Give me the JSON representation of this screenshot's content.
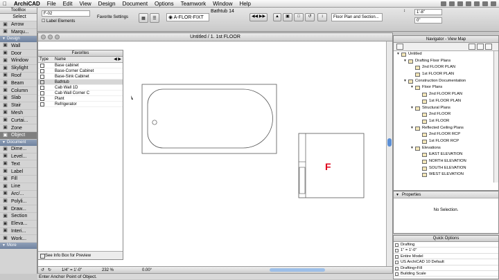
{
  "menubar": {
    "app": "ArchiCAD",
    "items": [
      "File",
      "Edit",
      "View",
      "Design",
      "Document",
      "Options",
      "Teamwork",
      "Window",
      "Help"
    ]
  },
  "infobox": {
    "id_value": "F-02",
    "label_elements": "Label Elements",
    "favorite_settings": "Favorite Settings",
    "layer_value": "A-FLOR-FIXT",
    "object_name": "Bathtub 14",
    "floor_plan_section": "Floor Plan and Section...",
    "dim_top": "1'-8\"",
    "dim_bottom": "0\"",
    "angle_value": "0\""
  },
  "toolbox": {
    "title": "ToolBox",
    "select_label": "Select",
    "design_header": "Design",
    "document_header": "Document",
    "more_label": "More",
    "select_tools": [
      {
        "label": "Arrow",
        "icon": "arrow-icon"
      },
      {
        "label": "Marqu...",
        "icon": "marquee-icon"
      }
    ],
    "design_tools": [
      {
        "label": "Wall",
        "icon": "wall-icon"
      },
      {
        "label": "Door",
        "icon": "door-icon"
      },
      {
        "label": "Window",
        "icon": "window-icon"
      },
      {
        "label": "Skylight",
        "icon": "skylight-icon"
      },
      {
        "label": "Roof",
        "icon": "roof-icon"
      },
      {
        "label": "Beam",
        "icon": "beam-icon"
      },
      {
        "label": "Column",
        "icon": "column-icon"
      },
      {
        "label": "Slab",
        "icon": "slab-icon"
      },
      {
        "label": "Stair",
        "icon": "stair-icon"
      },
      {
        "label": "Mesh",
        "icon": "mesh-icon"
      },
      {
        "label": "Curtai...",
        "icon": "curtain-wall-icon"
      },
      {
        "label": "Zone",
        "icon": "zone-icon"
      },
      {
        "label": "Object",
        "icon": "object-icon",
        "selected": true
      }
    ],
    "document_tools": [
      {
        "label": "Dime...",
        "icon": "dimension-icon"
      },
      {
        "label": "Level...",
        "icon": "level-dimension-icon"
      },
      {
        "label": "Text",
        "icon": "text-icon"
      },
      {
        "label": "Label",
        "icon": "label-icon"
      },
      {
        "label": "Fill",
        "icon": "fill-icon"
      },
      {
        "label": "Line",
        "icon": "line-icon"
      },
      {
        "label": "Arc/...",
        "icon": "arc-icon"
      },
      {
        "label": "Polyli...",
        "icon": "polyline-icon"
      },
      {
        "label": "Draw...",
        "icon": "drawing-icon"
      },
      {
        "label": "Section",
        "icon": "section-icon"
      },
      {
        "label": "Eleva...",
        "icon": "elevation-icon"
      },
      {
        "label": "Interi...",
        "icon": "interior-elevation-icon"
      },
      {
        "label": "Work...",
        "icon": "worksheet-icon"
      }
    ]
  },
  "main_window": {
    "title": "Untitled / 1. 1st FLOOR",
    "scale": "1/4\"  =  1'-0\"",
    "zoom": "232 %",
    "angle": "0.00°"
  },
  "favorites": {
    "title": "Favorites",
    "col_type": "Type",
    "col_name": "Name",
    "items": [
      "Base cabinet",
      "Base-Corner Cabinet",
      "Base-Sink Cabinet",
      "Bathtub",
      "Cab Wall 1D",
      "Cab Wall Corner C",
      "Plant",
      "Refrigerator"
    ],
    "selected_index": 3,
    "footer": "See Info Box for Preview"
  },
  "navigator": {
    "title": "Navigator - View Map",
    "tree": [
      {
        "label": "Untitled",
        "level": 0
      },
      {
        "label": "Drafting Floor Plans",
        "level": 1
      },
      {
        "label": "2nd FLOOR PLAN",
        "level": 2
      },
      {
        "label": "1st FLOOR PLAN",
        "level": 2
      },
      {
        "label": "Construction Documentation",
        "level": 1
      },
      {
        "label": "Floor Plans",
        "level": 2
      },
      {
        "label": "2nd FLOOR PLAN",
        "level": 3
      },
      {
        "label": "1st FLOOR PLAN",
        "level": 3
      },
      {
        "label": "Structural Plans",
        "level": 2
      },
      {
        "label": "2nd FLOOR",
        "level": 3
      },
      {
        "label": "1st FLOOR",
        "level": 3
      },
      {
        "label": "Reflected Ceiling Plans",
        "level": 2
      },
      {
        "label": "2nd FLOOR RCP",
        "level": 3
      },
      {
        "label": "1st FLOOR RCP",
        "level": 3
      },
      {
        "label": "Elevations",
        "level": 2
      },
      {
        "label": "EAST ELEVATION",
        "level": 3
      },
      {
        "label": "NORTH ELEVATION",
        "level": 3
      },
      {
        "label": "SOUTH ELEVATION",
        "level": 3
      },
      {
        "label": "WEST ELEVATION",
        "level": 3
      }
    ]
  },
  "properties": {
    "title": "Properties",
    "empty_text": "No Selection."
  },
  "quick_options": {
    "title": "Quick Options",
    "rows": [
      "Drafting",
      "1\"  =  1'-0\"",
      "Entire Model",
      "US ArchiCAD 10 Default",
      "Drafting+Fill",
      "Building Scale"
    ]
  },
  "statusline": {
    "text": "Enter Anchor Point of Object."
  },
  "drawing": {
    "marker_letter": "F",
    "marker_color": "#e0001a"
  }
}
